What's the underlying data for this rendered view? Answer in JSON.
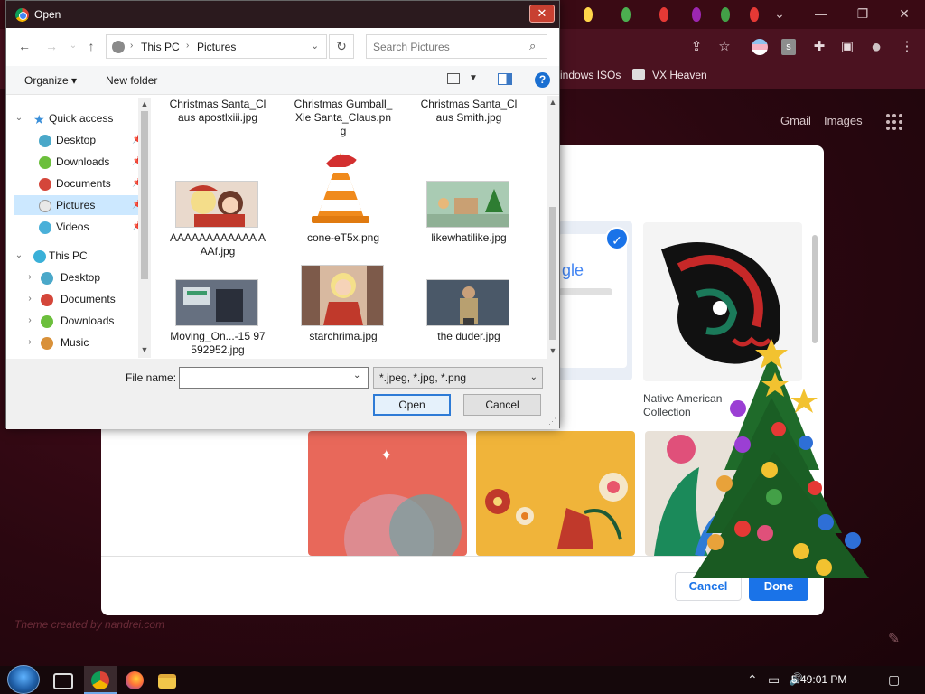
{
  "dialog": {
    "title": "Open",
    "close_glyph": "✕",
    "nav": {
      "back": "←",
      "forward": "→",
      "up": "↑"
    },
    "address": {
      "chev": "›",
      "root": "This PC",
      "folder": "Pictures",
      "dropdown": "⌄"
    },
    "refresh_glyph": "↻",
    "search_placeholder": "Search Pictures",
    "search_glyph": "⌕",
    "organize": "Organize ▾",
    "new_folder": "New folder",
    "help_glyph": "?",
    "nav_pane": [
      {
        "label": "Quick access",
        "icon": "star-icon",
        "color": "#3a8fd9",
        "arrow": "⌄",
        "pinned": false
      },
      {
        "label": "Desktop",
        "icon": "desktop-folder-icon",
        "color": "#4aa8c9",
        "arrow": "",
        "pinned": true
      },
      {
        "label": "Downloads",
        "icon": "downloads-folder-icon",
        "color": "#6cbf3c",
        "arrow": "",
        "pinned": true
      },
      {
        "label": "Documents",
        "icon": "documents-folder-icon",
        "color": "#d4463a",
        "arrow": "",
        "pinned": true
      },
      {
        "label": "Pictures",
        "icon": "pictures-folder-icon",
        "color": "#e8e8e8",
        "arrow": "",
        "pinned": true,
        "selected": true
      },
      {
        "label": "Videos",
        "icon": "videos-folder-icon",
        "color": "#4ab0d9",
        "arrow": "",
        "pinned": true
      },
      {
        "label": "This PC",
        "icon": "this-pc-icon",
        "color": "#3ab0d8",
        "arrow": "⌄",
        "pinned": false
      },
      {
        "label": "Desktop",
        "icon": "desktop-folder-icon",
        "color": "#4aa8c9",
        "arrow": "›",
        "pinned": false
      },
      {
        "label": "Documents",
        "icon": "documents-folder-icon",
        "color": "#d4463a",
        "arrow": "›",
        "pinned": false
      },
      {
        "label": "Downloads",
        "icon": "downloads-folder-icon",
        "color": "#6cbf3c",
        "arrow": "›",
        "pinned": false
      },
      {
        "label": "Music",
        "icon": "music-folder-icon",
        "color": "#d9913a",
        "arrow": "›",
        "pinned": false
      }
    ],
    "pin_glyph": "📌",
    "scroll": {
      "up": "▲",
      "down": "▼"
    },
    "files": [
      {
        "name": "Christmas Santa_Claus apostlxiii.jpg"
      },
      {
        "name": "Christmas Gumball_Xie Santa_Claus.png"
      },
      {
        "name": "Christmas Santa_Claus Smith.jpg"
      },
      {
        "name": "AAAAAAAAAAAA AAAf.jpg"
      },
      {
        "name": "cone-eT5x.png"
      },
      {
        "name": "likewhatilike.jpg"
      },
      {
        "name": "Moving_On...-15 97592952.jpg"
      },
      {
        "name": "starchrima.jpg"
      },
      {
        "name": "the duder.jpg"
      }
    ],
    "file_name_label": "File name:",
    "file_name_value": "",
    "file_type": "*.jpeg, *.jpg, *.png",
    "open_button": "Open",
    "cancel_button": "Cancel",
    "grip_glyph": "⋰"
  },
  "browser": {
    "bookmarks": [
      "indows ISOs",
      "VX Heaven"
    ],
    "google_links": [
      "Gmail",
      "Images"
    ],
    "window_controls": {
      "menu": "⌄",
      "minimize": "—",
      "restore": "❐",
      "close": "✕"
    },
    "toolbar_icons": {
      "share": "⇪",
      "star": "☆",
      "extensions": "✚",
      "sidepanel": "▣",
      "profile": "●",
      "menu": "⋮"
    },
    "tile_label": "Native American Collection",
    "check_glyph": "✓",
    "dialog_cancel": "Cancel",
    "dialog_done": "Done",
    "theme_credit": "Theme created by nandrei.com",
    "pencil_glyph": "✎"
  },
  "taskbar": {
    "clock": "5:49:01 PM",
    "tray": {
      "show_hidden": "⌃",
      "network": "▭",
      "volume": "🔊",
      "notifications": "▢"
    }
  }
}
